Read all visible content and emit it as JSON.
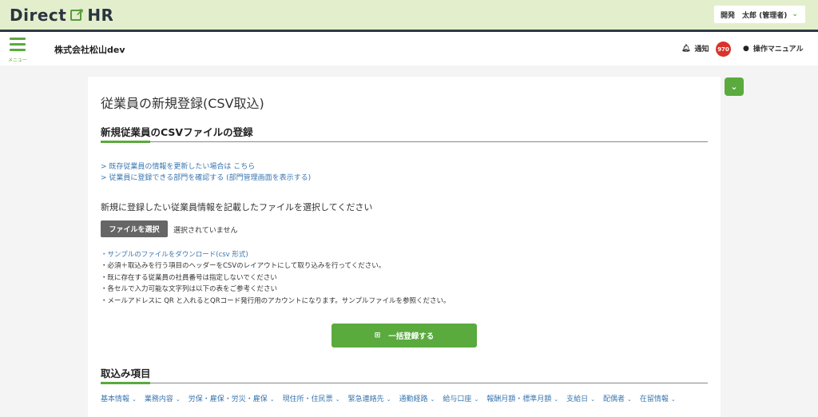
{
  "header": {
    "logo_left": "Direct",
    "logo_right": "HR",
    "user": "開発　太郎 (管理者)",
    "menu_label": "メニュー",
    "company": "株式会社松山dev",
    "notice_label": "通知",
    "notice_count": "970",
    "manual_label": "操作マニュアル"
  },
  "page": {
    "title": "従業員の新規登録(CSV取込)",
    "section_title": "新規従業員のCSVファイルの登録",
    "link1": "> 既存従業員の情報を更新したい場合は こちら",
    "link2": "> 従業員に登録できる部門を確認する (部門管理画面を表示する)",
    "instruction": "新規に登録したい従業員情報を記載したファイルを選択してください",
    "file_button": "ファイルを選択",
    "file_status": "選択されていません",
    "sample_link": "・サンプルのファイルをダウンロード(csv 形式)",
    "notes": [
      "・必須＋取込みを行う項目のヘッダーをCSVのレイアウトにして取り込みを行ってください。",
      "・既に存在する従業員の社員番号は指定しないでください",
      "・各セルで入力可能な文字列は以下の表をご参考ください",
      "・メールアドレスに QR と入れるとQRコード発行用のアカウントになります。サンプルファイルを参照ください。"
    ],
    "submit_button": "一括登録する",
    "import_title": "取込み項目"
  },
  "tabs": [
    "基本情報",
    "業務内容",
    "労保・雇保・労災・雇保",
    "現住所・住民票",
    "緊急連絡先",
    "通勤経路",
    "給与口座",
    "報酬月額・標準月額",
    "支給日",
    "配偶者",
    "在留情報"
  ],
  "colors": {
    "accent": "#5aaa3e",
    "topbar": "#e3efcc",
    "link": "#3a77b0",
    "badge": "#d9342b"
  }
}
